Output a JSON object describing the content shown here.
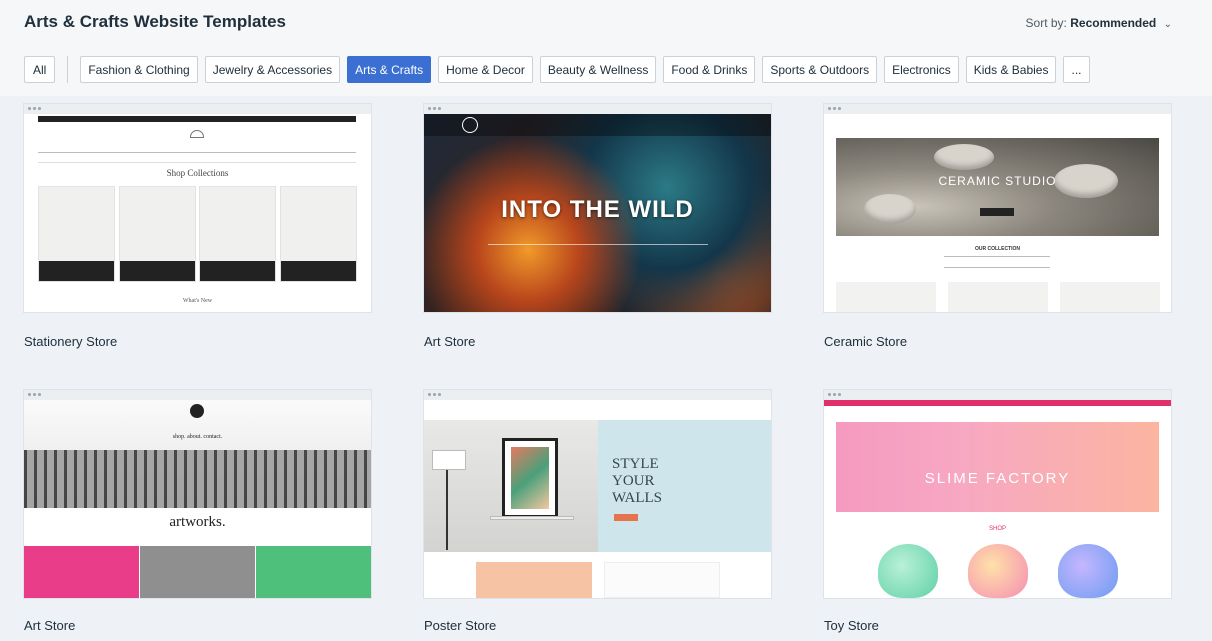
{
  "header": {
    "title": "Arts & Crafts Website Templates",
    "sort_label": "Sort by:",
    "sort_value": "Recommended"
  },
  "filters": [
    {
      "label": "All",
      "active": false
    },
    {
      "label": "Fashion & Clothing",
      "active": false
    },
    {
      "label": "Jewelry & Accessories",
      "active": false
    },
    {
      "label": "Arts & Crafts",
      "active": true
    },
    {
      "label": "Home & Decor",
      "active": false
    },
    {
      "label": "Beauty & Wellness",
      "active": false
    },
    {
      "label": "Food & Drinks",
      "active": false
    },
    {
      "label": "Sports & Outdoors",
      "active": false
    },
    {
      "label": "Electronics",
      "active": false
    },
    {
      "label": "Kids & Babies",
      "active": false
    },
    {
      "label": "...",
      "active": false
    }
  ],
  "templates": [
    {
      "name": "Stationery Store",
      "preview": {
        "heading": "Shop Collections",
        "footer": "What's New"
      }
    },
    {
      "name": "Art Store",
      "preview": {
        "hero": "INTO THE WILD"
      }
    },
    {
      "name": "Ceramic Store",
      "preview": {
        "hero": "CERAMIC STUDIO",
        "section": "OUR COLLECTION"
      }
    },
    {
      "name": "Art Store",
      "preview": {
        "wordmark": "artworks.",
        "menu": "shop.     about.     contact."
      }
    },
    {
      "name": "Poster Store",
      "preview": {
        "hero_line1": "STYLE",
        "hero_line2": "YOUR",
        "hero_line3": "WALLS"
      }
    },
    {
      "name": "Toy Store",
      "preview": {
        "hero": "SLIME FACTORY",
        "section": "SHOP"
      }
    }
  ],
  "colors": {
    "accent": "#3b6fd1",
    "background": "#eef2f6",
    "text": "#20303c"
  },
  "icons": {
    "sort_chevron": "chevron-down-icon",
    "window_dots": "window-dots-icon"
  }
}
